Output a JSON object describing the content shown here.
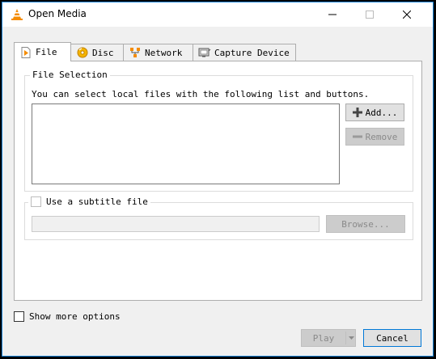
{
  "window": {
    "title": "Open Media"
  },
  "tabs": [
    {
      "label": "File",
      "icon": "file-icon",
      "active": true
    },
    {
      "label": "Disc",
      "icon": "disc-icon",
      "active": false
    },
    {
      "label": "Network",
      "icon": "network-icon",
      "active": false
    },
    {
      "label": "Capture Device",
      "icon": "capture-device-icon",
      "active": false
    }
  ],
  "file_selection": {
    "legend": "File Selection",
    "hint": "You can select local files with the following list and buttons.",
    "add_label": "Add...",
    "remove_label": "Remove"
  },
  "subtitle": {
    "label": "Use a subtitle file",
    "checked": false,
    "path_value": "",
    "browse_label": "Browse..."
  },
  "options": {
    "show_more_label": "Show more options",
    "checked": false
  },
  "footer": {
    "play_label": "Play",
    "cancel_label": "Cancel"
  },
  "colors": {
    "accent": "#0078d7",
    "vlc_orange": "#f48b00",
    "window_bg": "#f0f0f0",
    "panel_bg": "#ffffff"
  }
}
